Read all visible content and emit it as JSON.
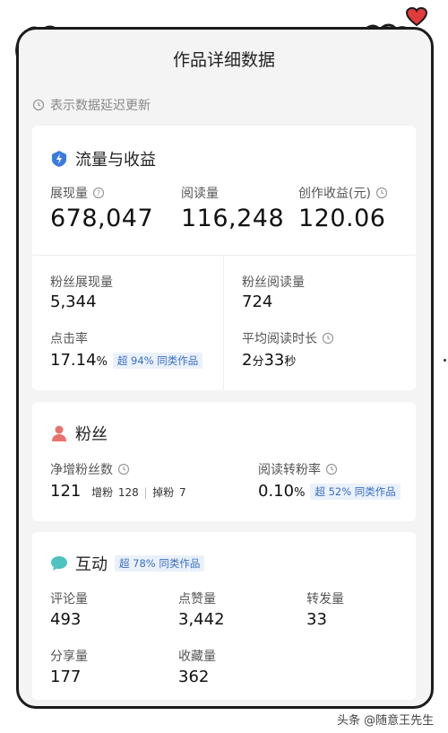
{
  "header": {
    "title": "作品详细数据",
    "notice": "表示数据延迟更新"
  },
  "traffic": {
    "title": "流量与收益",
    "icon": "lightning-shield-icon",
    "impressions": {
      "label": "展现量",
      "value": "678,047"
    },
    "reads": {
      "label": "阅读量",
      "value": "116,248"
    },
    "earnings": {
      "label": "创作收益(元)",
      "value": "120.06"
    },
    "fan_impressions": {
      "label": "粉丝展现量",
      "value": "5,344"
    },
    "fan_reads": {
      "label": "粉丝阅读量",
      "value": "724"
    },
    "ctr": {
      "label": "点击率",
      "value": "17.14",
      "unit": "%",
      "badge": "超 94% 同类作品"
    },
    "avg_read_time": {
      "label": "平均阅读时长",
      "min": "2",
      "min_unit": "分",
      "sec": "33",
      "sec_unit": "秒"
    }
  },
  "fans": {
    "title": "粉丝",
    "icon": "person-icon",
    "net_gain": {
      "label": "净增粉丝数",
      "value": "121",
      "gain_label": "增粉",
      "gain": "128",
      "loss_label": "掉粉",
      "loss": "7"
    },
    "conversion": {
      "label": "阅读转粉率",
      "value": "0.10",
      "unit": "%",
      "badge": "超 52% 同类作品"
    }
  },
  "interaction": {
    "title": "互动",
    "icon": "chat-bubble-icon",
    "badge": "超 78% 同类作品",
    "comments": {
      "label": "评论量",
      "value": "493"
    },
    "likes": {
      "label": "点赞量",
      "value": "3,442"
    },
    "shares_fwd": {
      "label": "转发量",
      "value": "33"
    },
    "shares": {
      "label": "分享量",
      "value": "177"
    },
    "favorites": {
      "label": "收藏量",
      "value": "362"
    }
  },
  "watermark": "头条 @随意王先生",
  "colors": {
    "accent_blue": "#3a7be0",
    "fans_red": "#e8736a",
    "chat_teal": "#4cc3c0",
    "badge_bg": "#eaf1fb",
    "badge_text": "#3a6fc4"
  }
}
